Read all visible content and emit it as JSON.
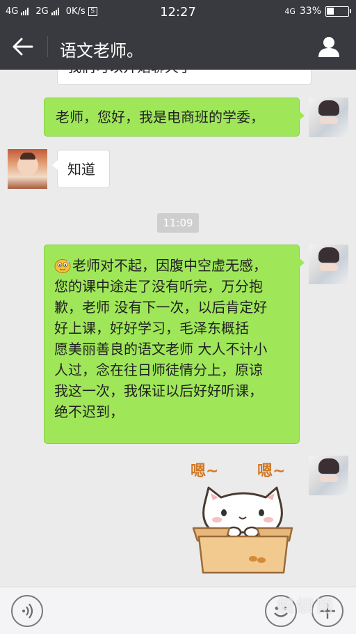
{
  "status_bar": {
    "net1": "4G",
    "net2": "2G",
    "speed": "0K/s",
    "speed_icon": "S",
    "time": "12:27",
    "net3": "4G",
    "battery": "33%"
  },
  "header": {
    "title": "语文老师。",
    "back_icon": "arrow-left-icon",
    "profile_icon": "person-icon",
    "bg_color": "#393a3f"
  },
  "messages": [
    {
      "side": "left",
      "text": "我们可以开始聊天了"
    },
    {
      "side": "right",
      "text": "老师，您好，我是电商班的学委，"
    },
    {
      "side": "left",
      "text": "知道"
    },
    {
      "type": "time",
      "text": "11:09"
    },
    {
      "side": "right",
      "emoji": "sweat-smile-emoji",
      "lines": [
        "老师对不起，因腹中空虚无感，",
        "您的课中途走了没有听完，万分抱",
        "歉，老师 没有下一次，以后肯定好",
        "好上课，好好学习，毛泽东概括",
        "愿美丽善良的语文老师 大人不计小",
        "人过，念在往日师徒情分上，原谅",
        "我这一次，我保证以后好好听课，",
        "绝不迟到，"
      ]
    },
    {
      "side": "right",
      "sticker": "cat-in-box-sticker",
      "sticker_text_1": "嗯~",
      "sticker_text_2": "嗯~"
    }
  ],
  "bottom_bar": {
    "voice_icon": "voice-icon",
    "emoji_icon": "emoji-icon",
    "plus_icon": "plus-icon"
  },
  "watermark": "蝈 蝈 网",
  "colors": {
    "bubble_right": "#9fe759",
    "bubble_left": "#ffffff",
    "chat_bg": "#ebebeb"
  }
}
